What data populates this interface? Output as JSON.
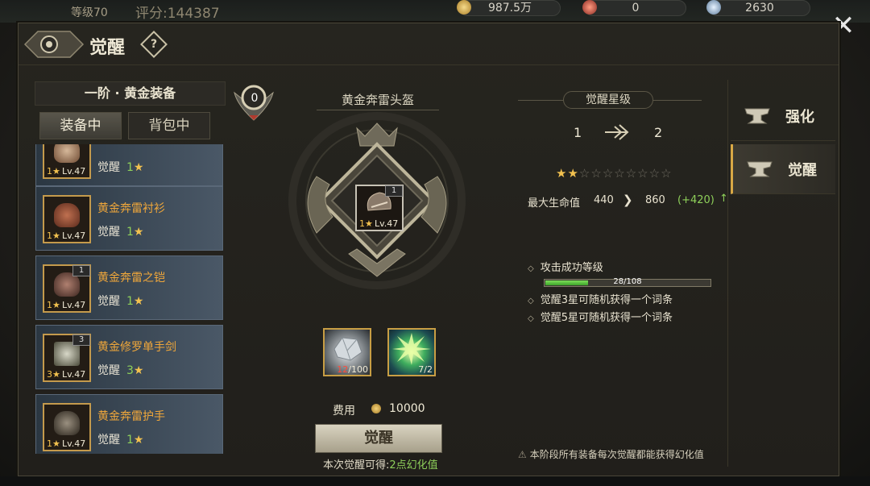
{
  "hud": {
    "level_text": "等级70",
    "score_text": "评分:144387",
    "gold": "987.5万",
    "gem": "0",
    "crystal": "2630"
  },
  "panel": {
    "title": "觉醒",
    "help": "?"
  },
  "left": {
    "tier_title": "一阶 · 黄金装备",
    "tabs": [
      "装备中",
      "背包中"
    ],
    "items": [
      {
        "name": "",
        "awaken_label": "觉醒",
        "stars": "1",
        "count": "",
        "star_badge": "1★",
        "lv": "Lv.47"
      },
      {
        "name": "黄金奔雷衬衫",
        "awaken_label": "觉醒",
        "stars": "1",
        "count": "",
        "star_badge": "1★",
        "lv": "Lv.47"
      },
      {
        "name": "黄金奔雷之铠",
        "awaken_label": "觉醒",
        "stars": "1",
        "count": "1",
        "star_badge": "1★",
        "lv": "Lv.47"
      },
      {
        "name": "黄金修罗单手剑",
        "awaken_label": "觉醒",
        "stars": "3",
        "count": "3",
        "star_badge": "3★",
        "lv": "Lv.47"
      },
      {
        "name": "黄金奔雷护手",
        "awaken_label": "觉醒",
        "stars": "1",
        "count": "",
        "star_badge": "1★",
        "lv": "Lv.47"
      }
    ]
  },
  "center": {
    "badge_value": "0",
    "item_title": "黄金奔雷头盔",
    "item": {
      "count": "1",
      "star_badge": "1★",
      "lv": "Lv.47"
    },
    "materials": [
      {
        "icon": "crystal-ore-icon",
        "have": "12",
        "need": "/100"
      },
      {
        "icon": "green-burst-icon",
        "have": "",
        "need": "7/2"
      }
    ],
    "cost_label": "费用",
    "cost_value": "10000",
    "awaken_button": "觉醒",
    "gain_prefix": "本次觉醒可得:",
    "gain_value": "2点幻化值"
  },
  "right": {
    "star_title": "觉醒星级",
    "level_from": "1",
    "level_to": "2",
    "stars_filled": 2,
    "stars_total": 10,
    "stat": {
      "name": "最大生命值",
      "from": "440",
      "arrow": "❯",
      "to": "860",
      "delta": "(+420)",
      "up": "↑"
    },
    "bullets": [
      "攻击成功等级",
      "觉醒3星可随机获得一个词条",
      "觉醒5星可随机获得一个词条"
    ],
    "progress": {
      "text": "28/108",
      "value": 28,
      "max": 108
    },
    "note": "本阶段所有装备每次觉醒都能获得幻化值"
  },
  "side_tabs": [
    {
      "label": "强化",
      "active": false
    },
    {
      "label": "觉醒",
      "active": true
    }
  ],
  "colors": {
    "accent_gold": "#d8a845",
    "green": "#8ed05a",
    "orange_name": "#f0a73a"
  }
}
